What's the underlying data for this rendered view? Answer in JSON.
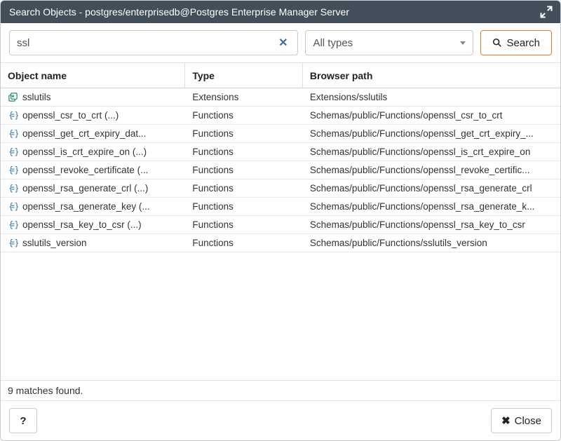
{
  "title": "Search Objects - postgres/enterprisedb@Postgres Enterprise Manager Server",
  "search": {
    "value": "ssl",
    "placeholder": ""
  },
  "type_filter": {
    "selected": "All types"
  },
  "search_button": "Search",
  "columns": {
    "name": "Object name",
    "type": "Type",
    "path": "Browser path"
  },
  "rows": [
    {
      "icon": "ext",
      "name": "sslutils",
      "type": "Extensions",
      "path": "Extensions/sslutils"
    },
    {
      "icon": "fn",
      "name": "openssl_csr_to_crt (...)",
      "type": "Functions",
      "path": "Schemas/public/Functions/openssl_csr_to_crt"
    },
    {
      "icon": "fn",
      "name": "openssl_get_crt_expiry_dat...",
      "type": "Functions",
      "path": "Schemas/public/Functions/openssl_get_crt_expiry_..."
    },
    {
      "icon": "fn",
      "name": "openssl_is_crt_expire_on (...)",
      "type": "Functions",
      "path": "Schemas/public/Functions/openssl_is_crt_expire_on"
    },
    {
      "icon": "fn",
      "name": "openssl_revoke_certificate (...",
      "type": "Functions",
      "path": "Schemas/public/Functions/openssl_revoke_certific..."
    },
    {
      "icon": "fn",
      "name": "openssl_rsa_generate_crl (...)",
      "type": "Functions",
      "path": "Schemas/public/Functions/openssl_rsa_generate_crl"
    },
    {
      "icon": "fn",
      "name": "openssl_rsa_generate_key (...",
      "type": "Functions",
      "path": "Schemas/public/Functions/openssl_rsa_generate_k..."
    },
    {
      "icon": "fn",
      "name": "openssl_rsa_key_to_csr (...)",
      "type": "Functions",
      "path": "Schemas/public/Functions/openssl_rsa_key_to_csr"
    },
    {
      "icon": "fn",
      "name": "sslutils_version",
      "type": "Functions",
      "path": "Schemas/public/Functions/sslutils_version"
    }
  ],
  "status": "9 matches found.",
  "footer": {
    "help": "?",
    "close": "Close"
  }
}
